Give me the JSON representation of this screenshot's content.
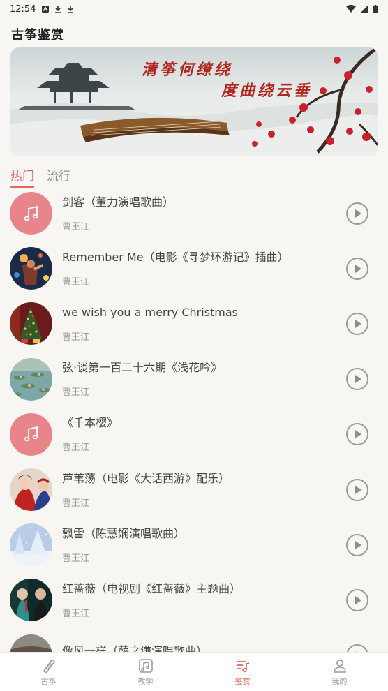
{
  "status_bar": {
    "time": "12:54"
  },
  "header": {
    "title": "古筝鉴赏"
  },
  "banner": {
    "line1": "清筝何缭绕",
    "line2": "度曲绕云垂"
  },
  "tabs": [
    {
      "label": "热门",
      "active": true
    },
    {
      "label": "流行",
      "active": false
    }
  ],
  "songs": [
    {
      "title": "剑客（董力演唱歌曲）",
      "artist": "曹王江",
      "cover": "note-icon"
    },
    {
      "title": "Remember Me（电影《寻梦环游记》插曲）",
      "artist": "曹王江",
      "cover": "coco-image"
    },
    {
      "title": "we wish you a merry Christmas",
      "artist": "曹王江",
      "cover": "christmas-tree-image"
    },
    {
      "title": "弦·谈第一百二十六期《浅花吟》",
      "artist": "曹王江",
      "cover": "water-lilies-image"
    },
    {
      "title": "《千本樱》",
      "artist": "曹王江",
      "cover": "note-icon"
    },
    {
      "title": "芦苇荡（电影《大话西游》配乐）",
      "artist": "曹王江",
      "cover": "opera-image"
    },
    {
      "title": "飘雪（陈慧娴演唱歌曲）",
      "artist": "曹王江",
      "cover": "snow-image"
    },
    {
      "title": "红蔷薇（电视剧《红蔷薇》主题曲）",
      "artist": "曹王江",
      "cover": "drama-image"
    },
    {
      "title": "像风一样（薛之谦演唱歌曲）",
      "artist": "",
      "cover": "landscape-image"
    }
  ],
  "bottom_nav": [
    {
      "label": "古筝",
      "icon": "guzheng-icon",
      "active": false
    },
    {
      "label": "教学",
      "icon": "teaching-icon",
      "active": false
    },
    {
      "label": "鉴赏",
      "icon": "appreciation-icon",
      "active": true
    },
    {
      "label": "我的",
      "icon": "profile-icon",
      "active": false
    }
  ],
  "colors": {
    "accent": "#e0655f",
    "note_cover": "#e8858a",
    "background": "#f8f6f2"
  }
}
